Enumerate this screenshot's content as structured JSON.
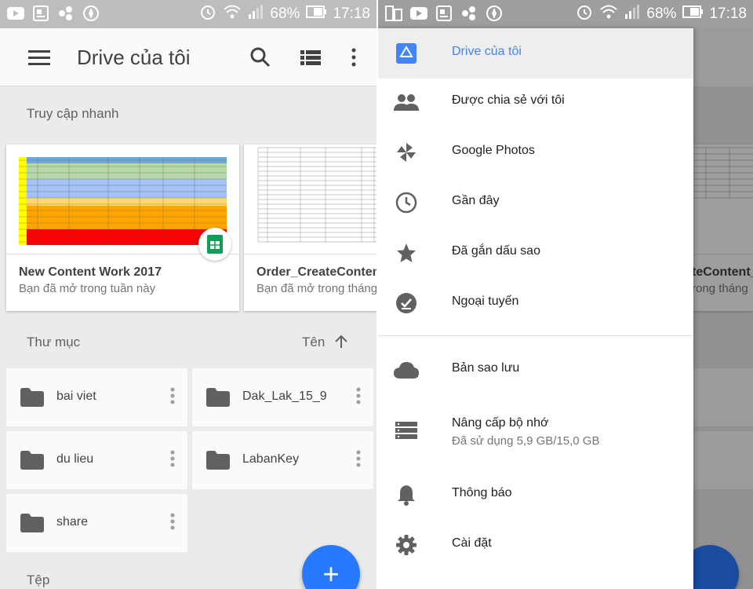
{
  "left": {
    "status": {
      "battery": "68%",
      "time": "17:18"
    },
    "appbar": {
      "title": "Drive của tôi"
    },
    "quick_access": {
      "label": "Truy cập nhanh",
      "cards": [
        {
          "title": "New Content Work 2017",
          "subtitle": "Bạn đã mở trong tuần này"
        },
        {
          "title": "Order_CreateContent_",
          "subtitle": "Bạn đã mở trong tháng"
        }
      ]
    },
    "folders": {
      "label": "Thư mục",
      "sort_label": "Tên",
      "items": [
        "bai viet",
        "Dak_Lak_15_9",
        "du lieu",
        "LabanKey",
        "share"
      ]
    },
    "files": {
      "label": "Tệp"
    },
    "fab": {
      "symbol": "+"
    }
  },
  "right": {
    "status": {
      "battery": "68%",
      "time": "17:18"
    },
    "behind": {
      "card_title": "teContent_",
      "card_subtitle": "rong tháng"
    },
    "drawer": {
      "items": [
        {
          "label": "Drive của tôi",
          "icon": "drive-icon"
        },
        {
          "label": "Được chia sẻ với tôi",
          "icon": "people-icon"
        },
        {
          "label": "Google Photos",
          "icon": "pinwheel-icon"
        },
        {
          "label": "Gần đây",
          "icon": "clock-icon"
        },
        {
          "label": "Đã gắn dấu sao",
          "icon": "star-icon"
        },
        {
          "label": "Ngoại tuyến",
          "icon": "offline-check-icon"
        },
        {
          "label": "Bản sao lưu",
          "icon": "cloud-icon"
        },
        {
          "label": "Nâng cấp bộ nhớ",
          "icon": "storage-icon",
          "sub": "Đã sử dụng 5,9 GB/15,0 GB"
        },
        {
          "label": "Thông báo",
          "icon": "bell-icon"
        },
        {
          "label": "Cài đặt",
          "icon": "gear-icon"
        }
      ]
    }
  },
  "colors": {
    "accent": "#4285f4",
    "fab": "#2979ff",
    "sheets_green": "#0f9d58"
  }
}
